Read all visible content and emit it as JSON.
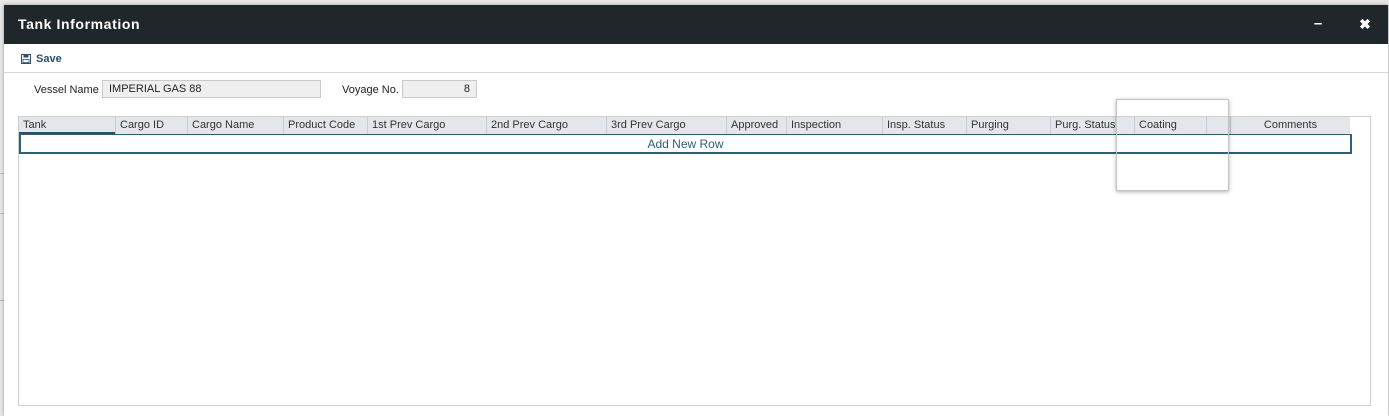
{
  "window": {
    "title": "Tank Information",
    "minimize_label": "–",
    "close_label": "✖"
  },
  "toolbar": {
    "save_label": "Save",
    "save_icon": "floppy-disk-icon"
  },
  "form": {
    "vessel_name_label": "Vessel Name",
    "vessel_name_value": "IMPERIAL GAS 88",
    "voyage_no_label": "Voyage No.",
    "voyage_no_value": "8"
  },
  "grid": {
    "columns": [
      "Tank",
      "Cargo ID",
      "Cargo Name",
      "Product Code",
      "1st Prev Cargo",
      "2nd Prev Cargo",
      "3rd Prev Cargo",
      "Approved",
      "Inspection",
      "Insp. Status",
      "Purging",
      "Purg. Status",
      "Coating",
      "",
      "Comments"
    ],
    "add_row_label": "Add New Row"
  },
  "colors": {
    "titlebar": "#1f272b",
    "accent": "#2d4f6a",
    "header_bg": "#e3e6ea"
  }
}
